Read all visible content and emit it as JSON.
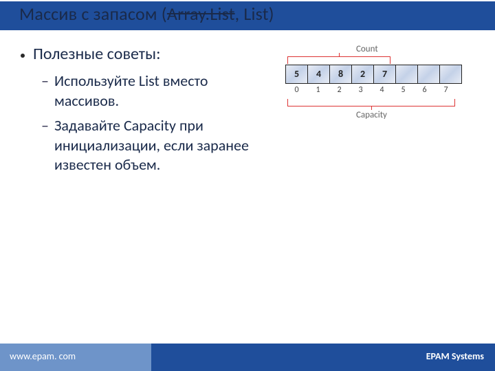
{
  "title": {
    "prefix": "Массив с запасом (",
    "strike": "Array.List",
    "mid": ", ",
    "rest": "List)"
  },
  "bullets": {
    "main": "Полезные советы:",
    "sub1": "Используйте List вместо массивов.",
    "sub2": "Задавайте Capacity при инициализации, если заранее известен объем."
  },
  "diagram": {
    "labelTop": "Count",
    "labelBottom": "Capacity",
    "cells": [
      "5",
      "4",
      "8",
      "2",
      "7",
      "",
      "",
      ""
    ],
    "indices": [
      "0",
      "1",
      "2",
      "3",
      "4",
      "5",
      "6",
      "7"
    ]
  },
  "footer": {
    "url": "www.epam. com",
    "brand": "EPAM Systems"
  },
  "dashes": {
    "d": "–"
  }
}
